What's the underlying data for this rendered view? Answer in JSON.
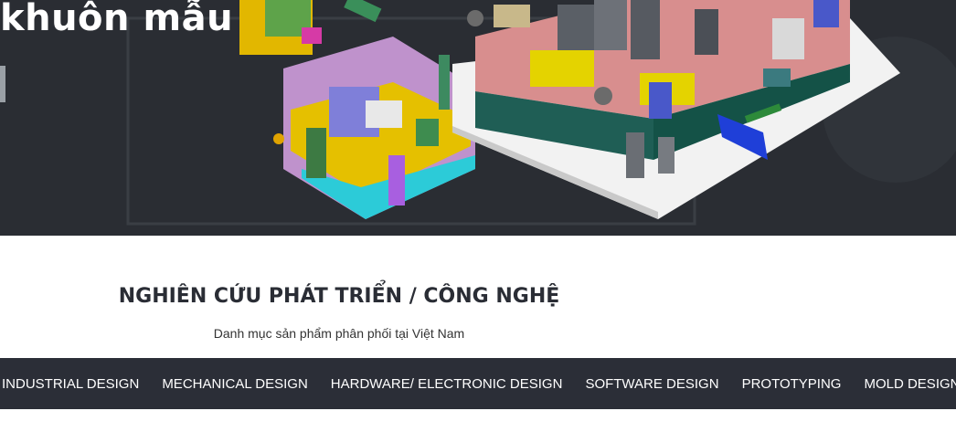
{
  "hero": {
    "title": "khuôn mẫu",
    "image_alt": "3D mold assembly models"
  },
  "section": {
    "title": "NGHIÊN CỨU PHÁT TRIỂN / CÔNG NGHỆ",
    "subtitle": "Danh mục sản phẩm phân phối tại Việt Nam"
  },
  "nav": {
    "items": [
      {
        "label": "INDUSTRIAL DESIGN"
      },
      {
        "label": "MECHANICAL DESIGN"
      },
      {
        "label": "HARDWARE/ ELECTRONIC DESIGN"
      },
      {
        "label": "SOFTWARE DESIGN"
      },
      {
        "label": "PROTOTYPING"
      },
      {
        "label": "MOLD DESIGN"
      }
    ]
  },
  "colors": {
    "hero_bg": "#2a2d33",
    "navbar_bg": "#2b2e37",
    "title_text": "#2a2d35"
  }
}
